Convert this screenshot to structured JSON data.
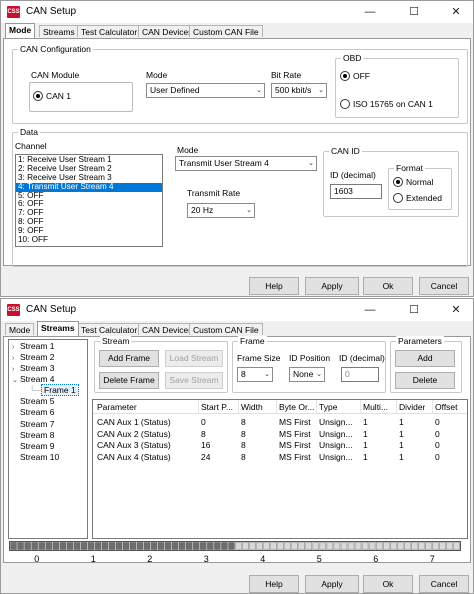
{
  "window1": {
    "title": "CAN Setup",
    "app_icon": "CSS",
    "tabs": [
      "Mode",
      "Streams",
      "Test Calculator",
      "CAN Devices",
      "Custom CAN File"
    ],
    "can_configuration": {
      "group_label": "CAN Configuration",
      "can_module_label": "CAN Module",
      "can_module_option": "CAN 1",
      "mode_label": "Mode",
      "mode_value": "User Defined",
      "bit_rate_label": "Bit Rate",
      "bit_rate_value": "500 kbit/s",
      "obd_label": "OBD",
      "obd_off": "OFF",
      "obd_iso": "ISO 15765 on CAN 1"
    },
    "data": {
      "group_label": "Data",
      "channel_label": "Channel",
      "channels": [
        "1: Receive User Stream 1",
        "2: Receive User Stream 2",
        "3: Receive User Stream 3",
        "4: Transmit User Stream 4",
        "5: OFF",
        "6: OFF",
        "7: OFF",
        "8: OFF",
        "9: OFF",
        "10: OFF"
      ],
      "selected_channel_index": 3,
      "mode_label": "Mode",
      "mode_value": "Transmit User Stream 4",
      "transmit_rate_label": "Transmit Rate",
      "transmit_rate_value": "20 Hz",
      "can_id_label": "CAN ID",
      "id_decimal_label": "ID (decimal)",
      "id_decimal_value": "1603",
      "format_label": "Format",
      "format_normal": "Normal",
      "format_extended": "Extended"
    },
    "buttons": {
      "help": "Help",
      "apply": "Apply",
      "ok": "Ok",
      "cancel": "Cancel"
    }
  },
  "window2": {
    "title": "CAN Setup",
    "app_icon": "CSS",
    "tabs": [
      "Mode",
      "Streams",
      "Test Calculator",
      "CAN Devices",
      "Custom CAN File"
    ],
    "tree": {
      "items": [
        "Stream 1",
        "Stream 2",
        "Stream 3",
        "Stream 4",
        "Frame 1",
        "Stream 5",
        "Stream 6",
        "Stream 7",
        "Stream 8",
        "Stream 9",
        "Stream 10"
      ]
    },
    "stream_group": {
      "label": "Stream",
      "add_frame": "Add Frame",
      "load_stream": "Load Stream",
      "delete_frame": "Delete Frame",
      "save_stream": "Save Stream"
    },
    "frame_group": {
      "label": "Frame",
      "frame_size_label": "Frame Size",
      "frame_size_value": "8",
      "id_position_label": "ID Position",
      "id_position_value": "None",
      "id_decimal_label": "ID (decimal)",
      "id_decimal_value": "0"
    },
    "parameters_group": {
      "label": "Parameters",
      "add": "Add",
      "delete": "Delete"
    },
    "table": {
      "columns": [
        "Parameter",
        "Start P...",
        "Width",
        "Byte Or...",
        "Type",
        "Multi...",
        "Divider",
        "Offset"
      ],
      "rows": [
        [
          "CAN Aux 1 (Status)",
          "0",
          "8",
          "MS First",
          "Unsign...",
          "1",
          "1",
          "0"
        ],
        [
          "CAN Aux 2 (Status)",
          "8",
          "8",
          "MS First",
          "Unsign...",
          "1",
          "1",
          "0"
        ],
        [
          "CAN Aux 3 (Status)",
          "16",
          "8",
          "MS First",
          "Unsign...",
          "1",
          "1",
          "0"
        ],
        [
          "CAN Aux 4 (Status)",
          "24",
          "8",
          "MS First",
          "Unsign...",
          "1",
          "1",
          "0"
        ]
      ]
    },
    "byte_ruler": {
      "labels": [
        "0",
        "1",
        "2",
        "3",
        "4",
        "5",
        "6",
        "7"
      ],
      "filled_bits": 32,
      "total_bits": 64
    },
    "buttons": {
      "help": "Help",
      "apply": "Apply",
      "ok": "Ok",
      "cancel": "Cancel"
    }
  }
}
